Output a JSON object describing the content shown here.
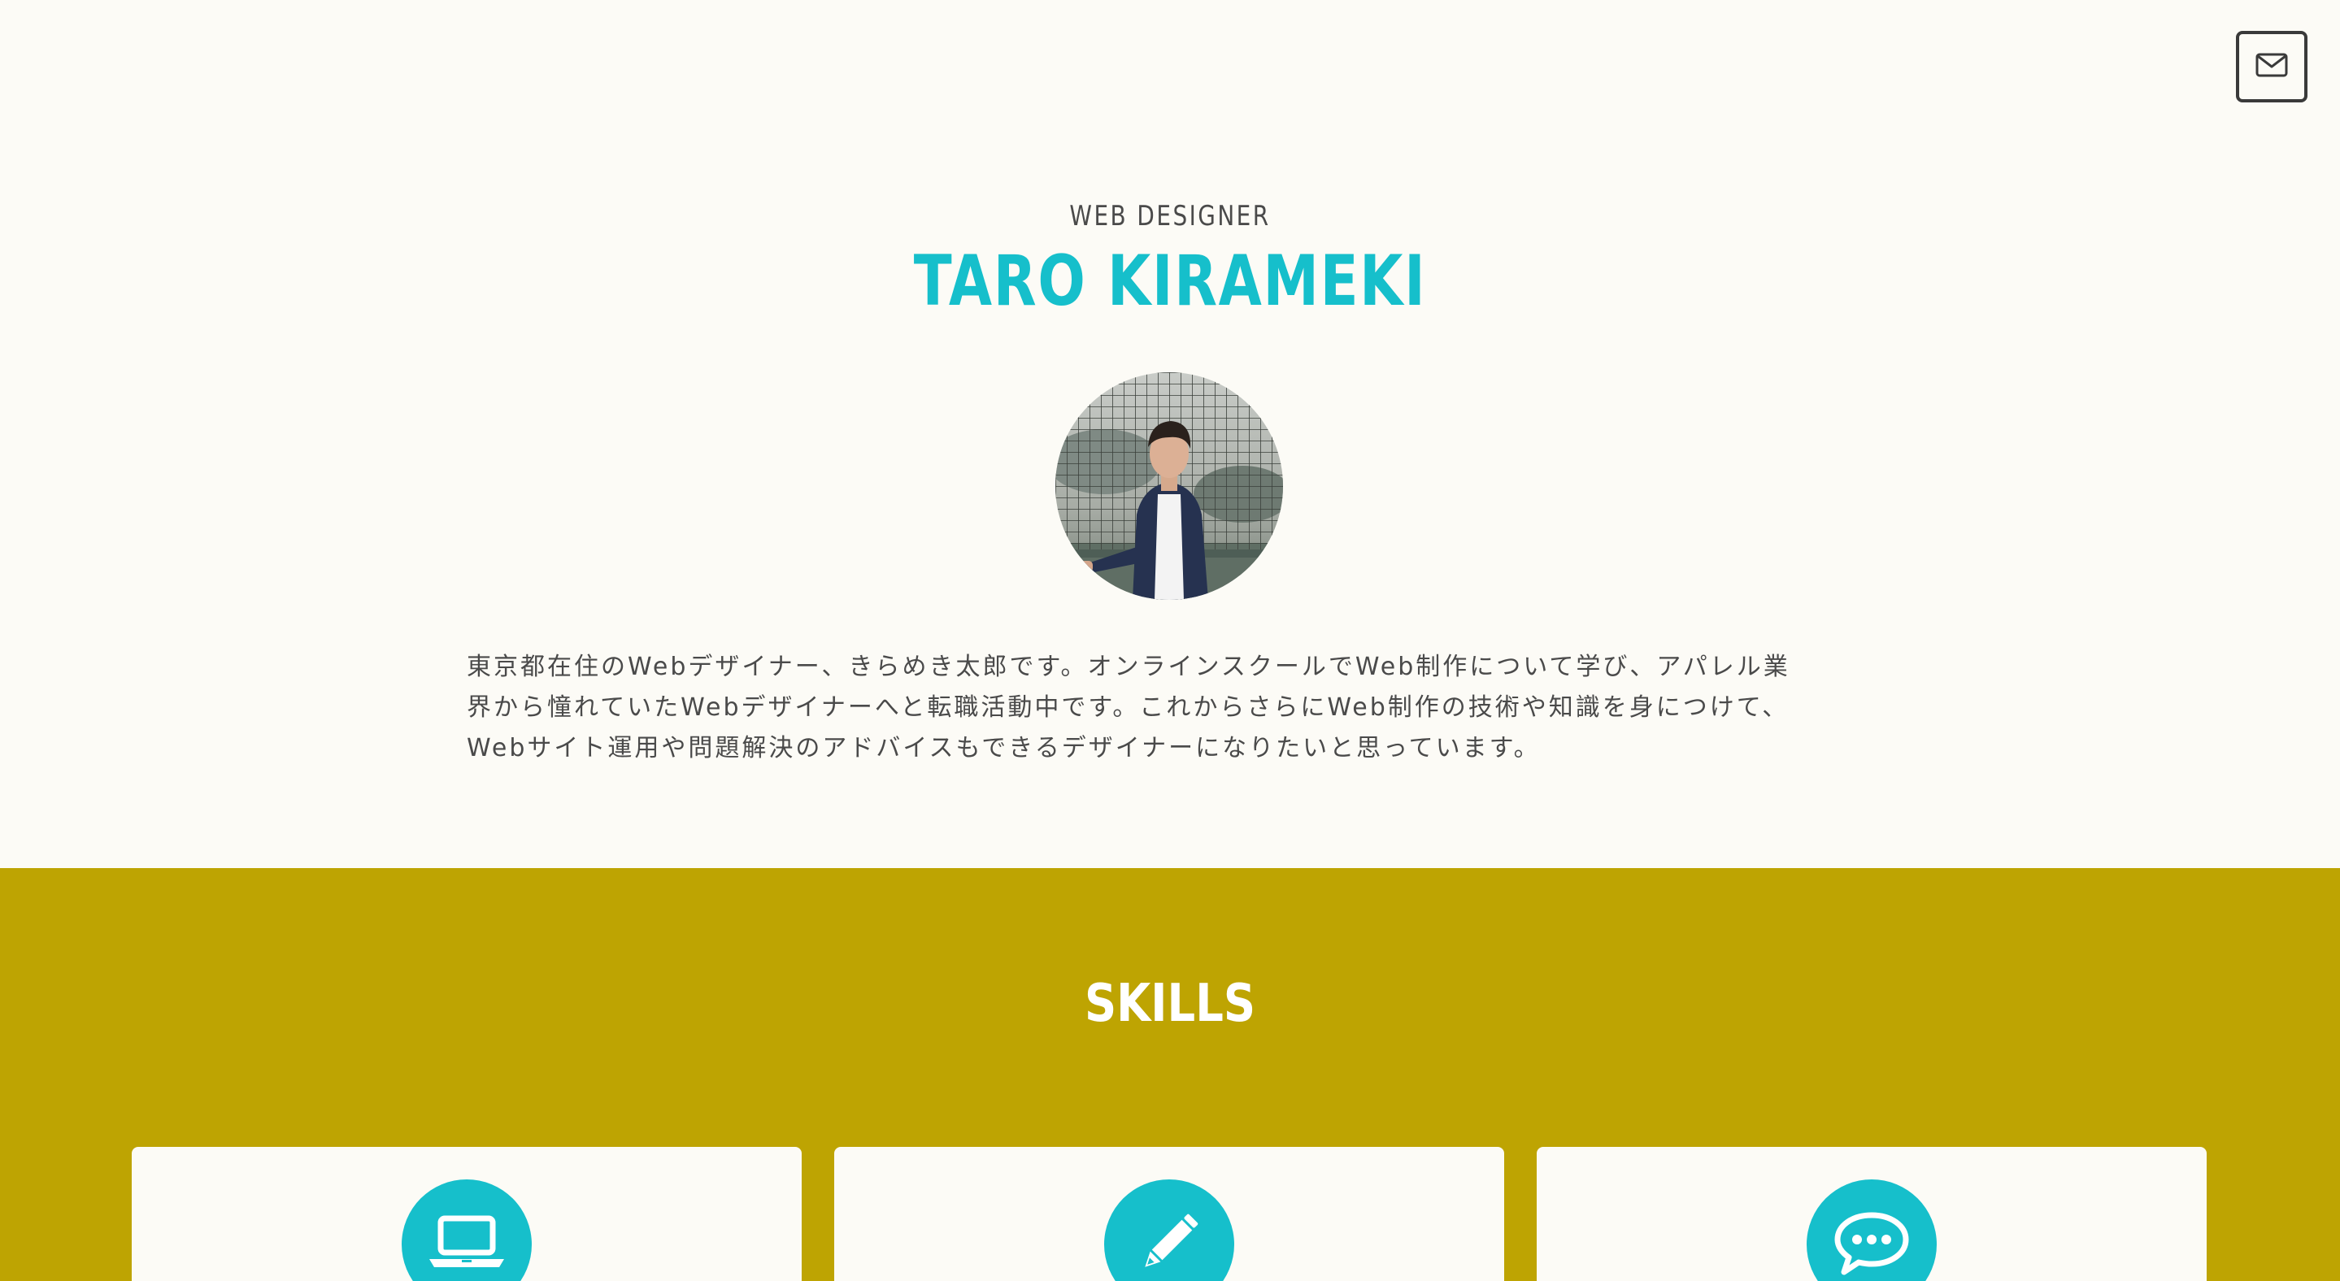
{
  "header": {
    "mail_icon": "envelope-icon"
  },
  "hero": {
    "role": "WEB DESIGNER",
    "name": "TARO KIRAMEKI",
    "bio_lines": [
      "東京都在住のWebデザイナー、きらめき太郎です。オンラインスクールでWeb制作について学び、アパレル業",
      "界から憧れていたWebデザイナーへと転職活動中です。これからさらにWeb制作の技術や知識を身につけて、",
      "Webサイト運用や問題解決のアドバイスもできるデザイナーになりたいと思っています。"
    ]
  },
  "skills": {
    "title": "SKILLS",
    "cards": [
      {
        "icon": "laptop-icon"
      },
      {
        "icon": "pencil-icon"
      },
      {
        "icon": "chat-bubble-icon"
      }
    ]
  },
  "colors": {
    "accent": "#16bfcb",
    "skills_bg": "#bea402",
    "page_bg": "#fcfbf6",
    "text": "#4a4a4a"
  }
}
